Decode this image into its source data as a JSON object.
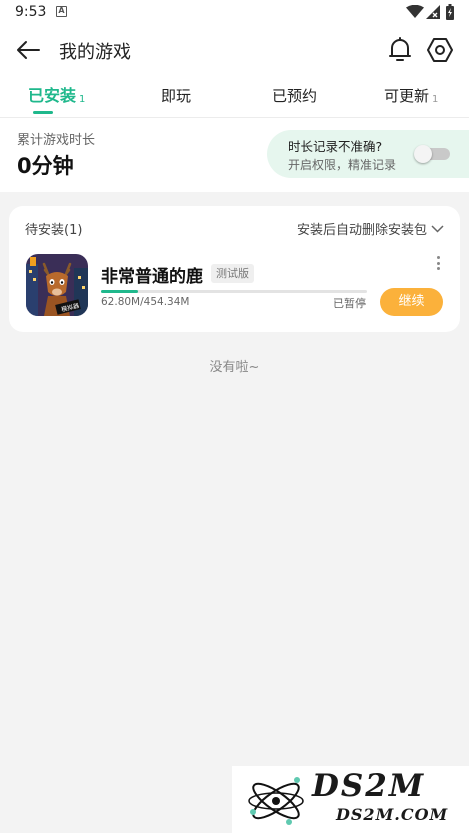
{
  "status_bar": {
    "time": "9:53",
    "notif_glyph": "A"
  },
  "header": {
    "title": "我的游戏"
  },
  "tabs": [
    {
      "label": "已安装",
      "count": "1"
    },
    {
      "label": "即玩",
      "count": ""
    },
    {
      "label": "已预约",
      "count": ""
    },
    {
      "label": "可更新",
      "count": "1"
    }
  ],
  "playtime": {
    "label": "累计游戏时长",
    "value": "0分钟",
    "record_title": "时长记录不准确?",
    "record_sub": "开启权限，精准记录",
    "toggle_on": false
  },
  "pending": {
    "title": "待安装(1)",
    "auto_delete_label": "安装后自动删除安装包",
    "game": {
      "name": "非常普通的鹿",
      "badge": "测试版",
      "size": "62.80M/454.34M",
      "progress": 0.138,
      "status": "已暂停",
      "action": "继续"
    }
  },
  "footer": {
    "end_text": "没有啦~"
  },
  "watermark": {
    "text": "DS2M",
    "url": "DS2M.COM"
  },
  "colors": {
    "accent": "#1fb88c",
    "continue": "#fbb13b",
    "background": "#f3f3f3"
  }
}
